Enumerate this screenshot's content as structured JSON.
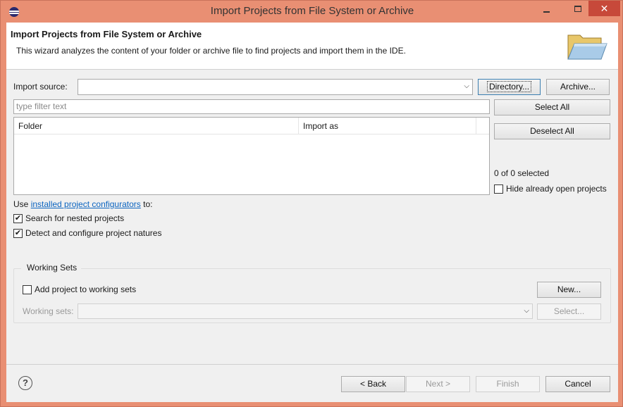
{
  "window": {
    "title": "Import Projects from File System or Archive"
  },
  "header": {
    "title": "Import Projects from File System or Archive",
    "description": "This wizard analyzes the content of your folder or archive file to find projects and import them in the IDE."
  },
  "import_source": {
    "label": "Import source:",
    "value": "",
    "directory_button": "Directory...",
    "archive_button": "Archive..."
  },
  "filter": {
    "placeholder": "type filter text"
  },
  "table": {
    "columns": [
      "Folder",
      "Import as"
    ],
    "rows": []
  },
  "selection": {
    "select_all": "Select All",
    "deselect_all": "Deselect All",
    "selected_count": "0 of 0 selected",
    "hide_open_projects": "Hide already open projects",
    "hide_open_checked": false
  },
  "configurators": {
    "prefix": "Use ",
    "link": "installed project configurators",
    "suffix": " to:",
    "search_nested": "Search for nested projects",
    "search_nested_checked": true,
    "detect_natures": "Detect and configure project natures",
    "detect_natures_checked": true
  },
  "working_sets": {
    "group_label": "Working Sets",
    "add_label": "Add project to working sets",
    "add_checked": false,
    "new_button": "New...",
    "sets_label": "Working sets:",
    "sets_value": "",
    "select_button": "Select..."
  },
  "footer": {
    "back": "< Back",
    "next": "Next >",
    "finish": "Finish",
    "cancel": "Cancel"
  },
  "colors": {
    "title_bar": "#e98f73",
    "close_button": "#c7493a",
    "link": "#0b64c0"
  }
}
